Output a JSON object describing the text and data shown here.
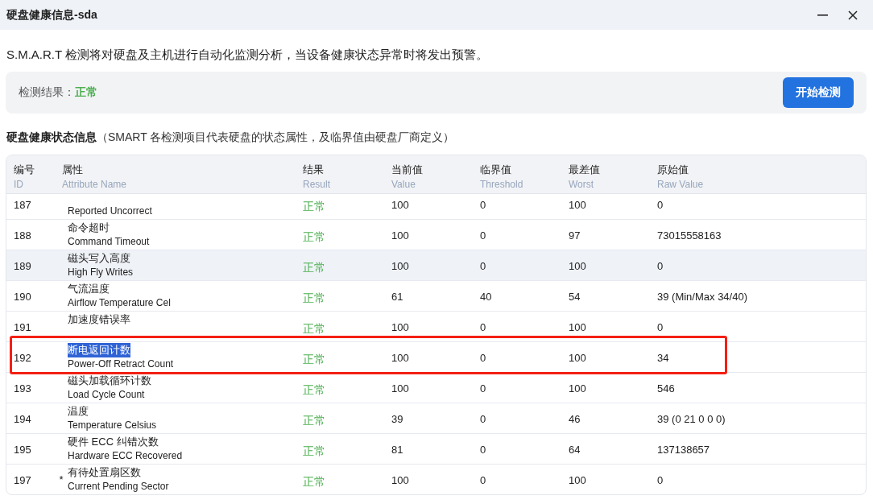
{
  "window": {
    "title": "硬盘健康信息-sda"
  },
  "description": "S.M.A.R.T 检测将对硬盘及主机进行自动化监测分析，当设备健康状态异常时将发出预警。",
  "result_panel": {
    "label": "检测结果：",
    "status": "正常",
    "button": "开始检测"
  },
  "section": {
    "title": "硬盘健康状态信息",
    "note": "（SMART 各检测项目代表硬盘的状态属性，及临界值由硬盘厂商定义）"
  },
  "table": {
    "columns": [
      {
        "zh": "编号",
        "en": "ID"
      },
      {
        "zh": "属性",
        "en": "Attribute Name"
      },
      {
        "zh": "结果",
        "en": "Result"
      },
      {
        "zh": "当前值",
        "en": "Value"
      },
      {
        "zh": "临界值",
        "en": "Threshold"
      },
      {
        "zh": "最差值",
        "en": "Worst"
      },
      {
        "zh": "原始值",
        "en": "Raw Value"
      }
    ],
    "rows": [
      {
        "id": "187",
        "name_en": "Reported Uncorrect",
        "result": "正常",
        "value": "100",
        "threshold": "0",
        "worst": "100",
        "raw": "0",
        "hovered": false
      },
      {
        "id": "188",
        "name_zh": "命令超时",
        "name_en": "Command Timeout",
        "result": "正常",
        "value": "100",
        "threshold": "0",
        "worst": "97",
        "raw": "73015558163",
        "hovered": false
      },
      {
        "id": "189",
        "name_zh": "磁头写入高度",
        "name_en": "High Fly Writes",
        "result": "正常",
        "value": "100",
        "threshold": "0",
        "worst": "100",
        "raw": "0",
        "hovered": true
      },
      {
        "id": "190",
        "name_zh": "气流温度",
        "name_en": "Airflow Temperature Cel",
        "result": "正常",
        "value": "61",
        "threshold": "40",
        "worst": "54",
        "raw": "39 (Min/Max 34/40)",
        "hovered": false
      },
      {
        "id": "191",
        "name_zh": "加速度错误率",
        "result": "正常",
        "value": "100",
        "threshold": "0",
        "worst": "100",
        "raw": "0",
        "hovered": false
      },
      {
        "id": "192",
        "name_zh": "断电返回计数",
        "name_en": "Power-Off Retract Count",
        "result": "正常",
        "value": "100",
        "threshold": "0",
        "worst": "100",
        "raw": "34",
        "hovered": false,
        "name_selected": true,
        "boxed": true
      },
      {
        "id": "193",
        "name_zh": "磁头加载循环计数",
        "name_en": "Load Cycle Count",
        "result": "正常",
        "value": "100",
        "threshold": "0",
        "worst": "100",
        "raw": "546",
        "hovered": false
      },
      {
        "id": "194",
        "name_zh": "温度",
        "name_en": "Temperature Celsius",
        "result": "正常",
        "value": "39",
        "threshold": "0",
        "worst": "46",
        "raw": "39 (0 21 0 0 0)",
        "hovered": false
      },
      {
        "id": "195",
        "name_zh": "硬件 ECC 纠错次数",
        "name_en": "Hardware ECC Recovered",
        "result": "正常",
        "value": "81",
        "threshold": "0",
        "worst": "64",
        "raw": "137138657",
        "hovered": false
      },
      {
        "id": "197",
        "flag": "*",
        "name_zh": "有待处置扇区数",
        "name_en": "Current Pending Sector",
        "result": "正常",
        "value": "100",
        "threshold": "0",
        "worst": "100",
        "raw": "0",
        "hovered": false
      }
    ]
  }
}
